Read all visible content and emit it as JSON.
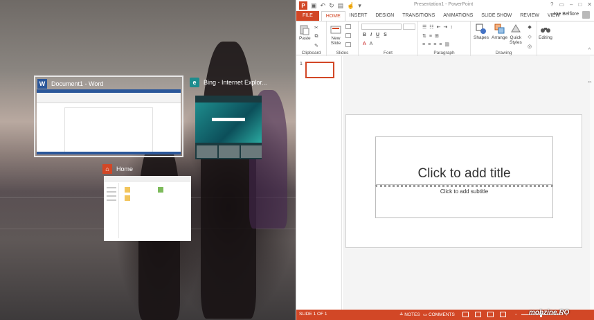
{
  "snap_assist": {
    "windows": [
      {
        "title": "Document1 - Word",
        "app": "Word"
      },
      {
        "title": "Bing - Internet Explor...",
        "app": "Internet Explorer"
      },
      {
        "title": "Home",
        "app": "File Explorer"
      }
    ]
  },
  "powerpoint": {
    "window_title": "Presentation1 - PowerPoint",
    "tabs": [
      "FILE",
      "HOME",
      "INSERT",
      "DESIGN",
      "TRANSITIONS",
      "ANIMATIONS",
      "SLIDE SHOW",
      "REVIEW",
      "VIEW"
    ],
    "active_tab": "HOME",
    "user_name": "Joe Belfiore",
    "ribbon_groups": {
      "clipboard": "Clipboard",
      "slides": "Slides",
      "font": "Font",
      "paragraph": "Paragraph",
      "drawing": "Drawing"
    },
    "buttons": {
      "paste": "Paste",
      "new_slide_1": "New",
      "new_slide_2": "Slide",
      "bold": "B",
      "italic": "I",
      "underline": "U",
      "strike": "S",
      "shapes": "Shapes",
      "arrange": "Arrange",
      "quick_styles_1": "Quick",
      "quick_styles_2": "Styles",
      "editing": "Editing"
    },
    "slide_panel": {
      "slide_number": "1"
    },
    "slide": {
      "title_placeholder": "Click to add title",
      "subtitle_placeholder": "Click to add subtitle"
    },
    "status": {
      "slide_count": "SLIDE 1 OF 1",
      "notes": "NOTES",
      "comments": "COMMENTS",
      "zoom_minus": "-",
      "zoom_plus": "+"
    },
    "watermark": "mobzine.RO"
  },
  "colors": {
    "accent": "#d24726",
    "word_blue": "#2b579a",
    "ie_teal": "#1e8c8d",
    "home_red": "#d24726"
  }
}
